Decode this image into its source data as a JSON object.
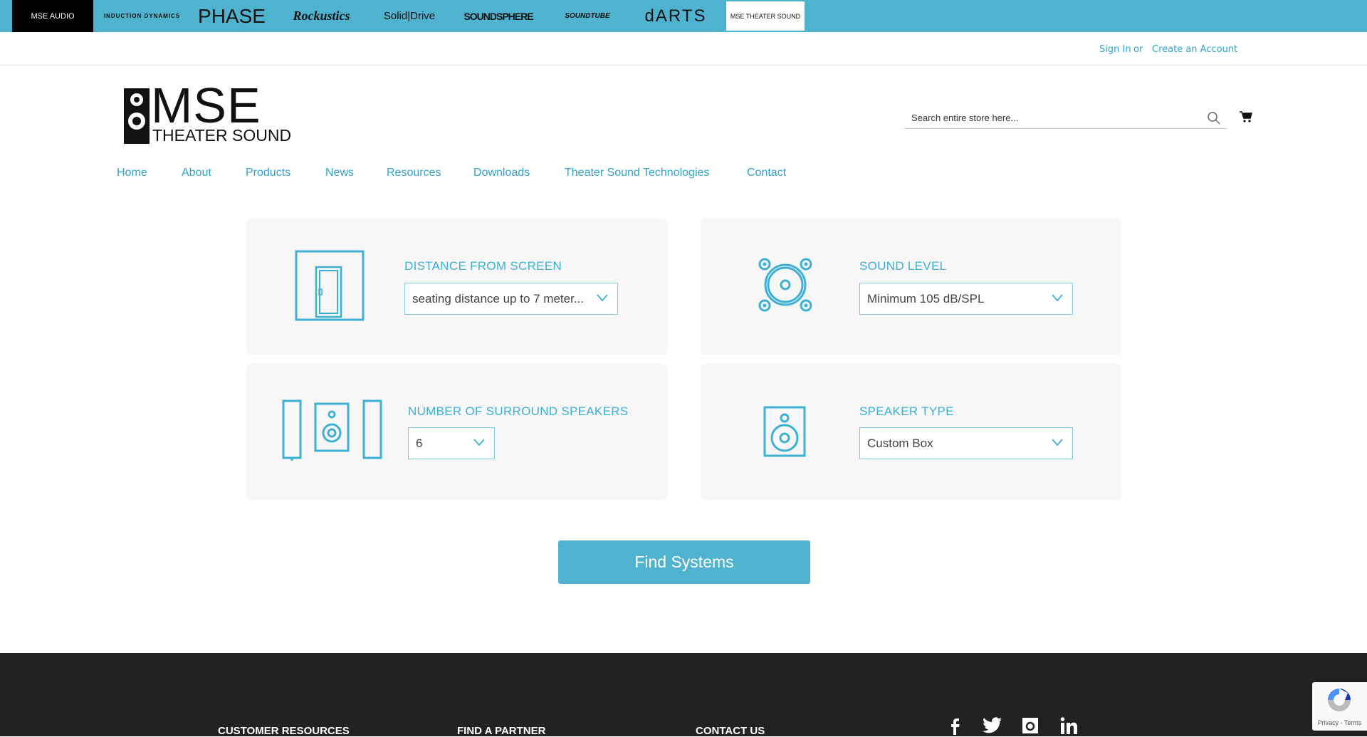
{
  "brand_bar": {
    "brands": [
      "MSE AUDIO",
      "INDUCTION DYNAMICS",
      "PHASE",
      "Rockustics",
      "Solid|Drive",
      "SOUNDSPHERE",
      "SOUNDTUBE",
      "dARTS",
      "MSE THEATER SOUND"
    ]
  },
  "account": {
    "sign_in": "Sign In",
    "or": "or",
    "create": "Create an Account"
  },
  "logo": {
    "line1": "MSE",
    "line2": "THEATER SOUND"
  },
  "search": {
    "placeholder": "Search entire store here..."
  },
  "nav": [
    "Home",
    "About",
    "Products",
    "News",
    "Resources",
    "Downloads",
    "Theater Sound Technologies",
    "Contact"
  ],
  "finder": {
    "distance": {
      "label": "DISTANCE FROM SCREEN",
      "value": "seating distance up to 7 meter..."
    },
    "sound": {
      "label": "SOUND LEVEL",
      "value": "Minimum 105 dB/SPL"
    },
    "surround": {
      "label": "NUMBER OF SURROUND SPEAKERS",
      "value": "6"
    },
    "type": {
      "label": "SPEAKER TYPE",
      "value": "Custom Box"
    },
    "button": "Find Systems"
  },
  "footer": {
    "headings": [
      "CUSTOMER RESOURCES",
      "FIND A PARTNER",
      "CONTACT US"
    ]
  },
  "recaptcha": {
    "text": "Privacy - Terms"
  },
  "colors": {
    "accent": "#4fb3d0",
    "link": "#2fa3c9",
    "footer": "#222222"
  }
}
